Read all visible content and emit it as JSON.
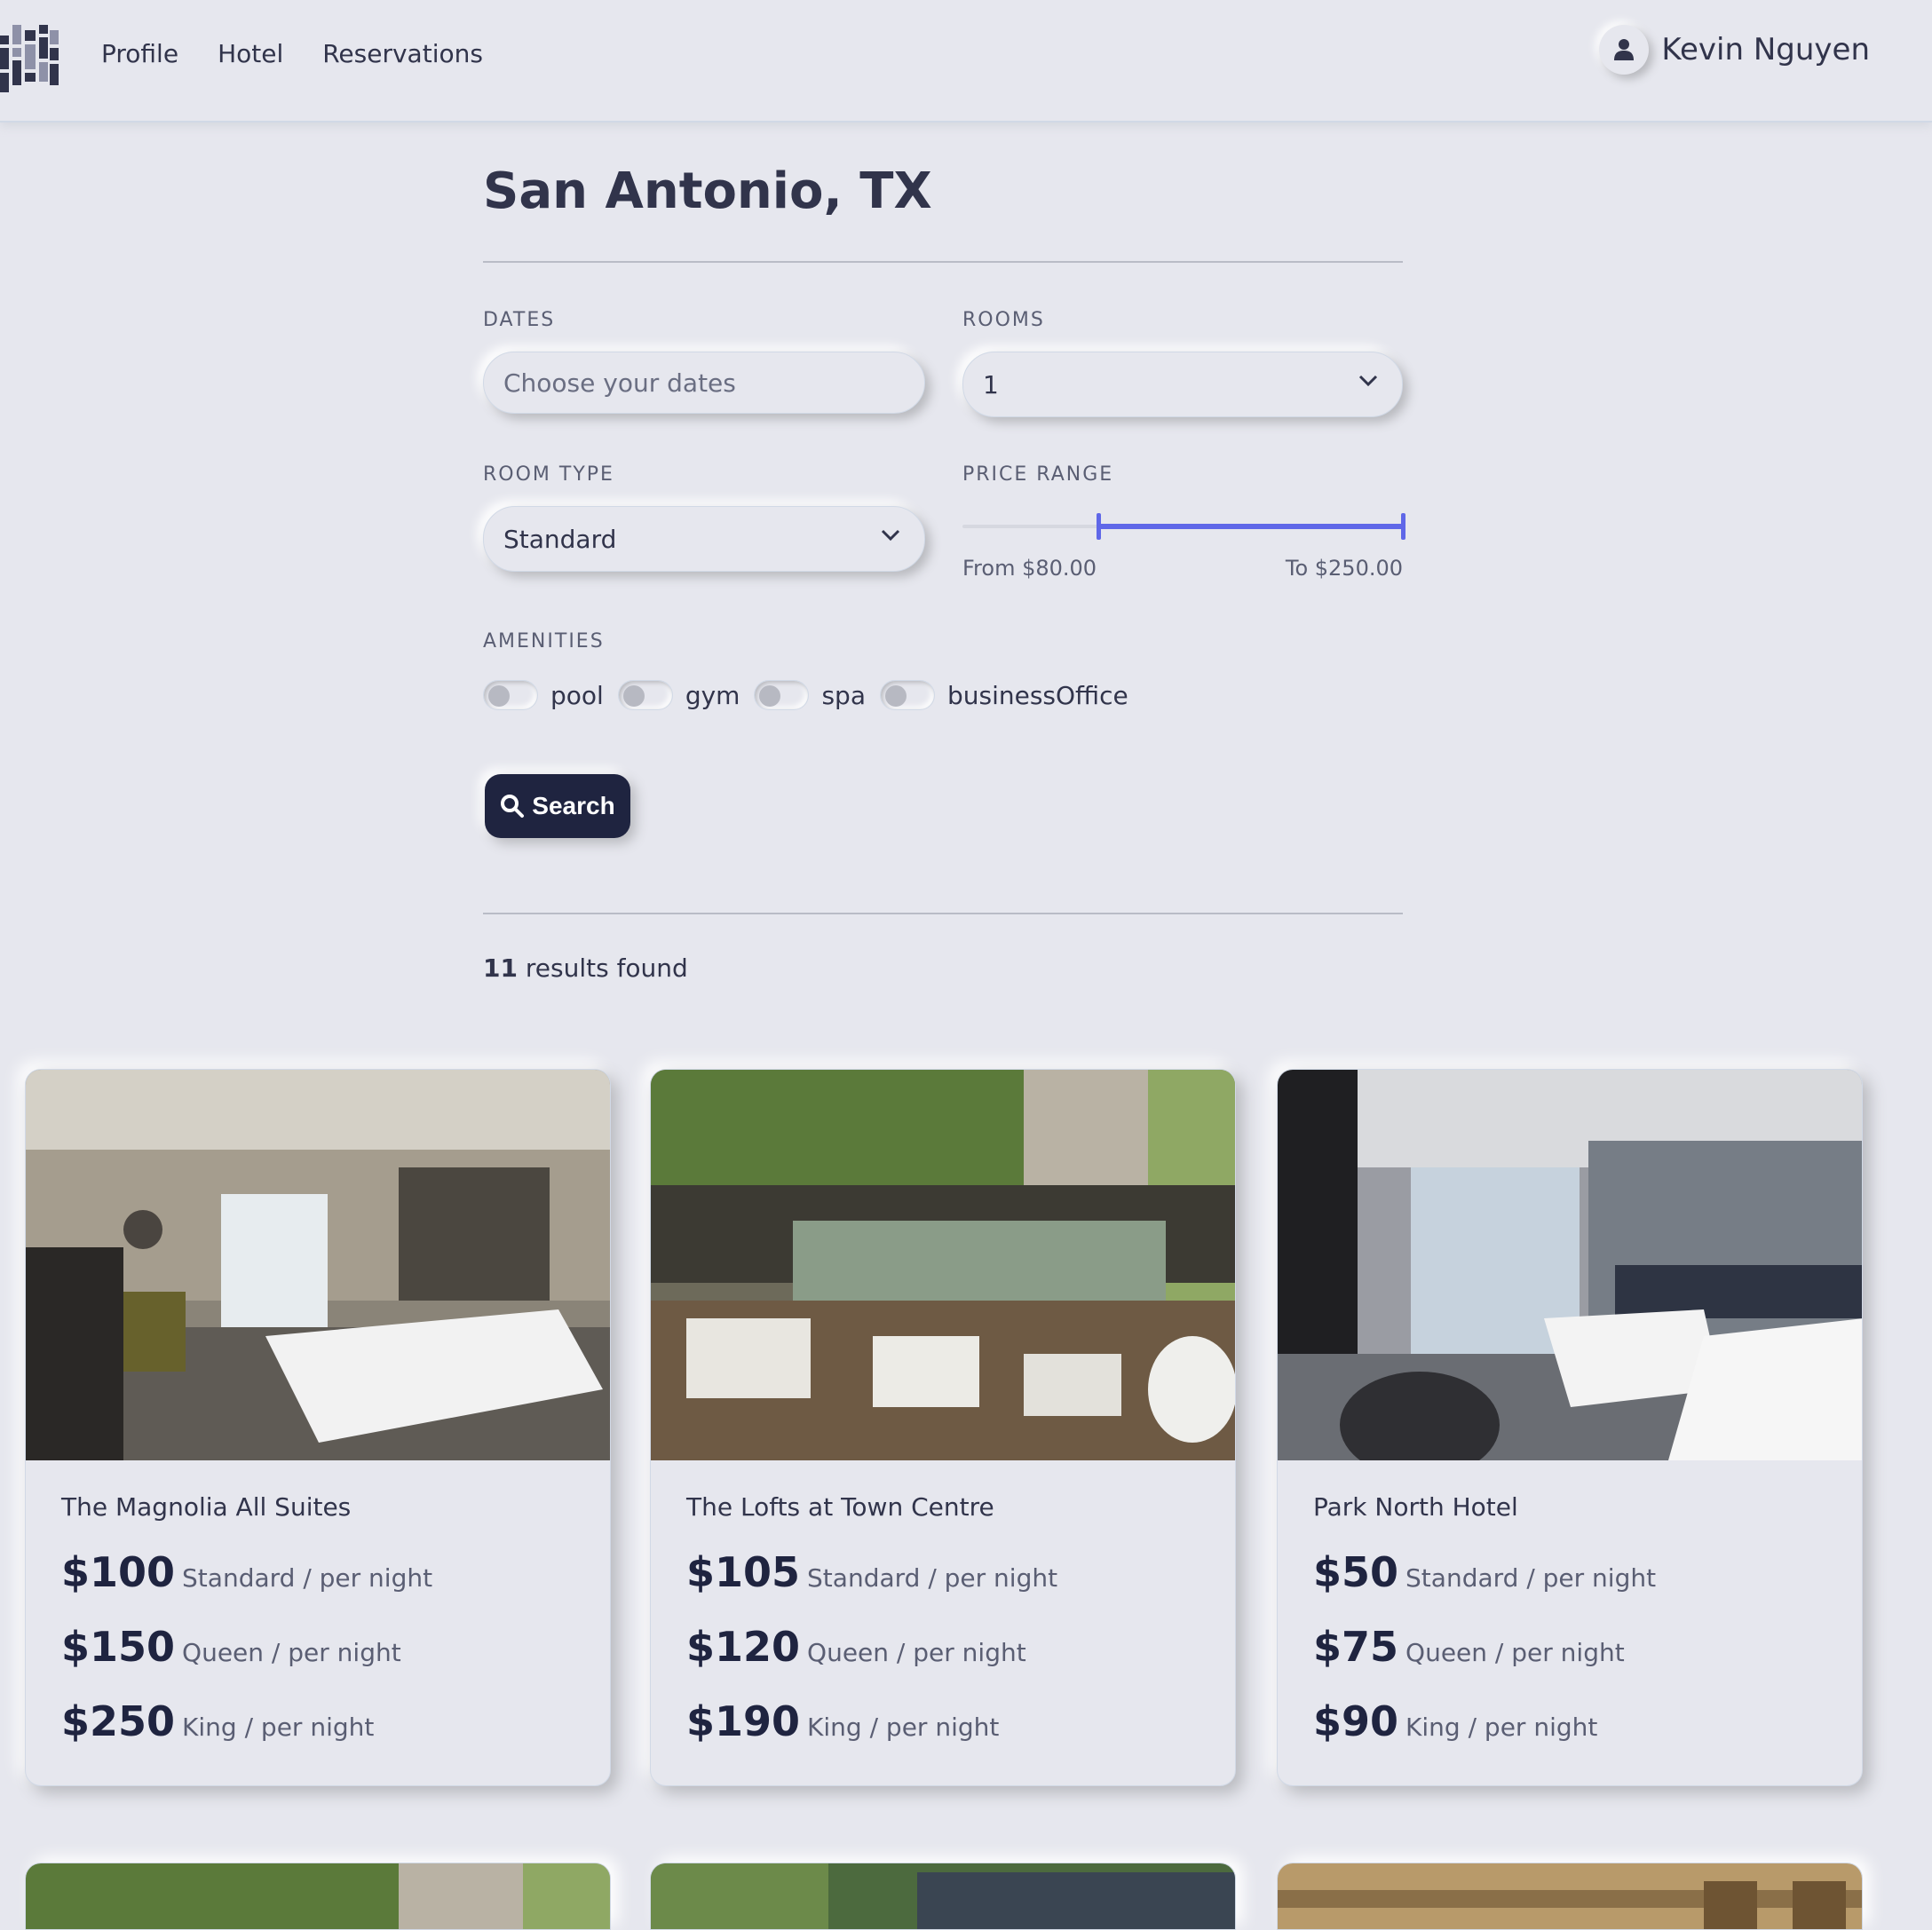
{
  "nav": {
    "links": [
      "Profile",
      "Hotel",
      "Reservations"
    ],
    "user_name": "Kevin Nguyen"
  },
  "search": {
    "title": "San Antonio, TX",
    "dates_label": "DATES",
    "dates_placeholder": "Choose your dates",
    "rooms_label": "ROOMS",
    "rooms_value": "1",
    "room_type_label": "ROOM TYPE",
    "room_type_value": "Standard",
    "price_label": "PRICE RANGE",
    "price_from": "From $80.00",
    "price_to": "To $250.00",
    "price_min_value": 80,
    "price_max_value": 250,
    "amenities_label": "AMENITIES",
    "amenities": [
      "pool",
      "gym",
      "spa",
      "businessOffice"
    ],
    "search_button": "Search"
  },
  "results": {
    "count": "11",
    "suffix": " results found"
  },
  "hotels": [
    {
      "name": "The Magnolia All Suites",
      "prices": [
        {
          "amount": "$100",
          "type": "Standard / per night"
        },
        {
          "amount": "$150",
          "type": "Queen / per night"
        },
        {
          "amount": "$250",
          "type": "King / per night"
        }
      ]
    },
    {
      "name": "The Lofts at Town Centre",
      "prices": [
        {
          "amount": "$105",
          "type": "Standard / per night"
        },
        {
          "amount": "$120",
          "type": "Queen / per night"
        },
        {
          "amount": "$190",
          "type": "King / per night"
        }
      ]
    },
    {
      "name": "Park North Hotel",
      "prices": [
        {
          "amount": "$50",
          "type": "Standard / per night"
        },
        {
          "amount": "$75",
          "type": "Queen / per night"
        },
        {
          "amount": "$90",
          "type": "King / per night"
        }
      ]
    }
  ],
  "colors": {
    "background": "#e6e7ee",
    "text": "#31344b",
    "accent": "#5f67e8",
    "button": "#1f2440"
  }
}
